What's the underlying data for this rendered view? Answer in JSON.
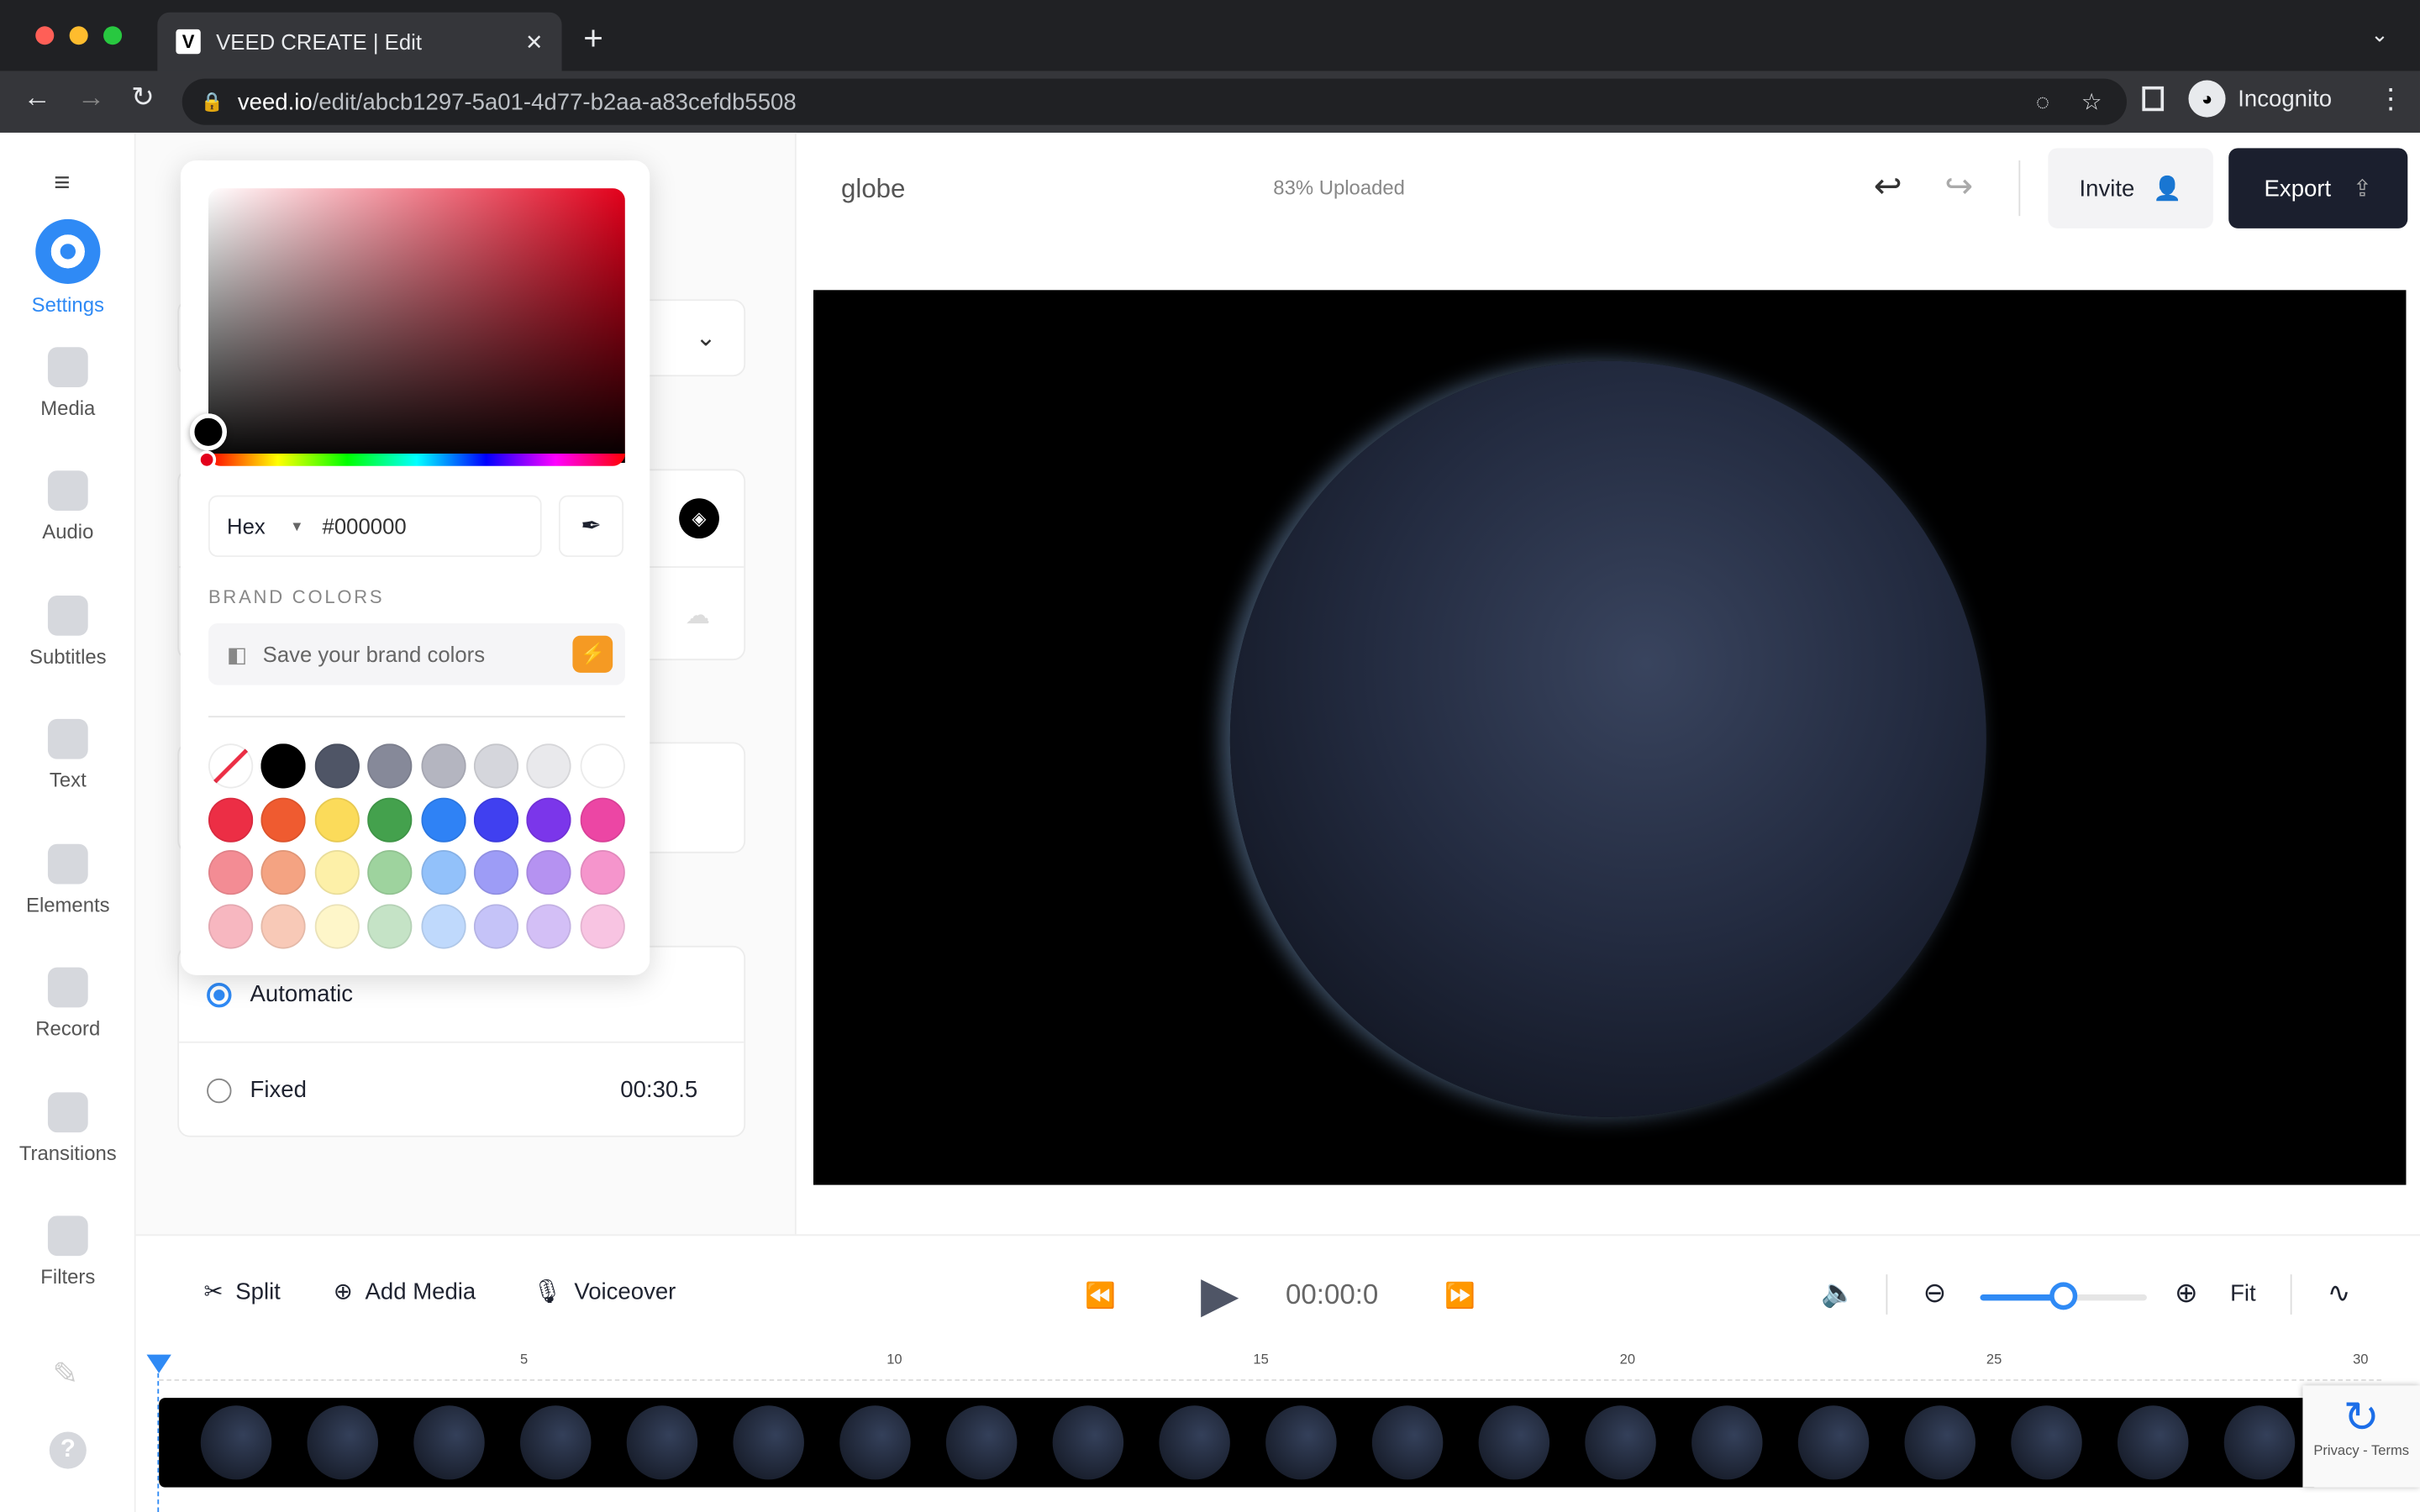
{
  "browser": {
    "tab_title": "VEED CREATE | Edit",
    "favicon": "V",
    "url_host": "veed.io",
    "url_path": "/edit/abcb1297-5a01-4d77-b2aa-a83cefdb5508",
    "profile": "Incognito"
  },
  "sidebar": {
    "items": [
      {
        "label": "Settings",
        "icon": "settings-icon"
      },
      {
        "label": "Media",
        "icon": "plus-icon"
      },
      {
        "label": "Audio",
        "icon": "music-icon"
      },
      {
        "label": "Subtitles",
        "icon": "subtitles-icon"
      },
      {
        "label": "Text",
        "icon": "text-icon"
      },
      {
        "label": "Elements",
        "icon": "sticker-icon"
      },
      {
        "label": "Record",
        "icon": "camera-icon"
      },
      {
        "label": "Transitions",
        "icon": "transition-icon"
      },
      {
        "label": "Filters",
        "icon": "filter-icon"
      }
    ]
  },
  "panel": {
    "duration_options": [
      {
        "label": "Automatic",
        "selected": true
      },
      {
        "label": "Fixed",
        "value": "00:30.5",
        "selected": false
      }
    ]
  },
  "color_picker": {
    "mode": "Hex",
    "value": "#000000",
    "brand_colors_label": "BRAND COLORS",
    "save_brand_label": "Save your brand colors",
    "hue_color": "#e3001b",
    "swatches": [
      [
        "none",
        "#000000",
        "#4f5566",
        "#868999",
        "#b4b5c0",
        "#d5d6dc",
        "#e9e9ec",
        "#ffffff"
      ],
      [
        "#ec2e45",
        "#ef5b30",
        "#fbdb5a",
        "#44a14d",
        "#2f82f5",
        "#4040f0",
        "#7b36ea",
        "#ec46a4"
      ],
      [
        "#f38c94",
        "#f4a382",
        "#fdf0a8",
        "#9ed39e",
        "#92c1fa",
        "#9d9cf6",
        "#b592f1",
        "#f595cc"
      ],
      [
        "#f7b7c0",
        "#f8c9b7",
        "#fef6c9",
        "#c5e3c6",
        "#bfd9fc",
        "#c5c3f8",
        "#d3bff6",
        "#f8c4e2"
      ]
    ]
  },
  "header": {
    "project_name": "globe",
    "upload_status": "83% Uploaded",
    "invite_label": "Invite",
    "export_label": "Export"
  },
  "timeline": {
    "split_label": "Split",
    "add_media_label": "Add Media",
    "voiceover_label": "Voiceover",
    "time": "00:00:0",
    "fit_label": "Fit",
    "zoom_level": 0.5,
    "ticks": [
      "5",
      "10",
      "15",
      "20",
      "25",
      "30"
    ]
  },
  "recaptcha": {
    "text": "Privacy - Terms"
  }
}
